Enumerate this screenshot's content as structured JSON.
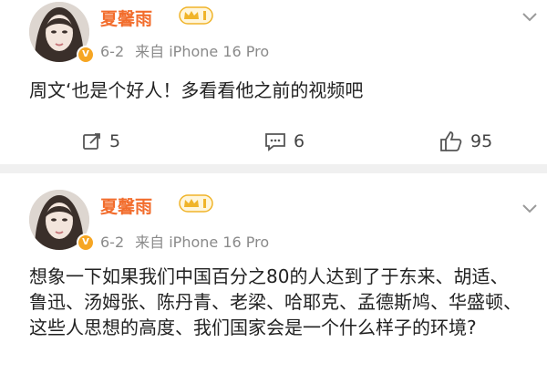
{
  "posts": [
    {
      "username": "夏馨雨",
      "date": "6-2",
      "source": "来自 iPhone 16 Pro",
      "content": "周文‘也是个好人！多看看他之前的视频吧",
      "actions": {
        "repost_count": "5",
        "comment_count": "6",
        "like_count": "95"
      }
    },
    {
      "username": "夏馨雨",
      "date": "6-2",
      "source": "来自 iPhone 16 Pro",
      "content": "想象一下如果我们中国百分之80的人达到了于东来、胡适、鲁迅、汤姆张、陈丹青、老梁、哈耶克、孟德斯鸠、华盛顿、这些人思想的高度、我们国家会是一个什么样子的环境?"
    }
  ],
  "icons": {
    "repost": "edit-share-icon",
    "comment": "comment-icon",
    "like": "thumbs-up-icon",
    "menu": "chevron-down-icon",
    "verified": "verified-badge-icon",
    "member": "crown-member-badge-icon"
  },
  "colors": {
    "username": "#f26d2d",
    "meta": "#8a8a8a",
    "text": "#222222",
    "divider": "#f0f0f0",
    "badge": "#f6a623"
  }
}
